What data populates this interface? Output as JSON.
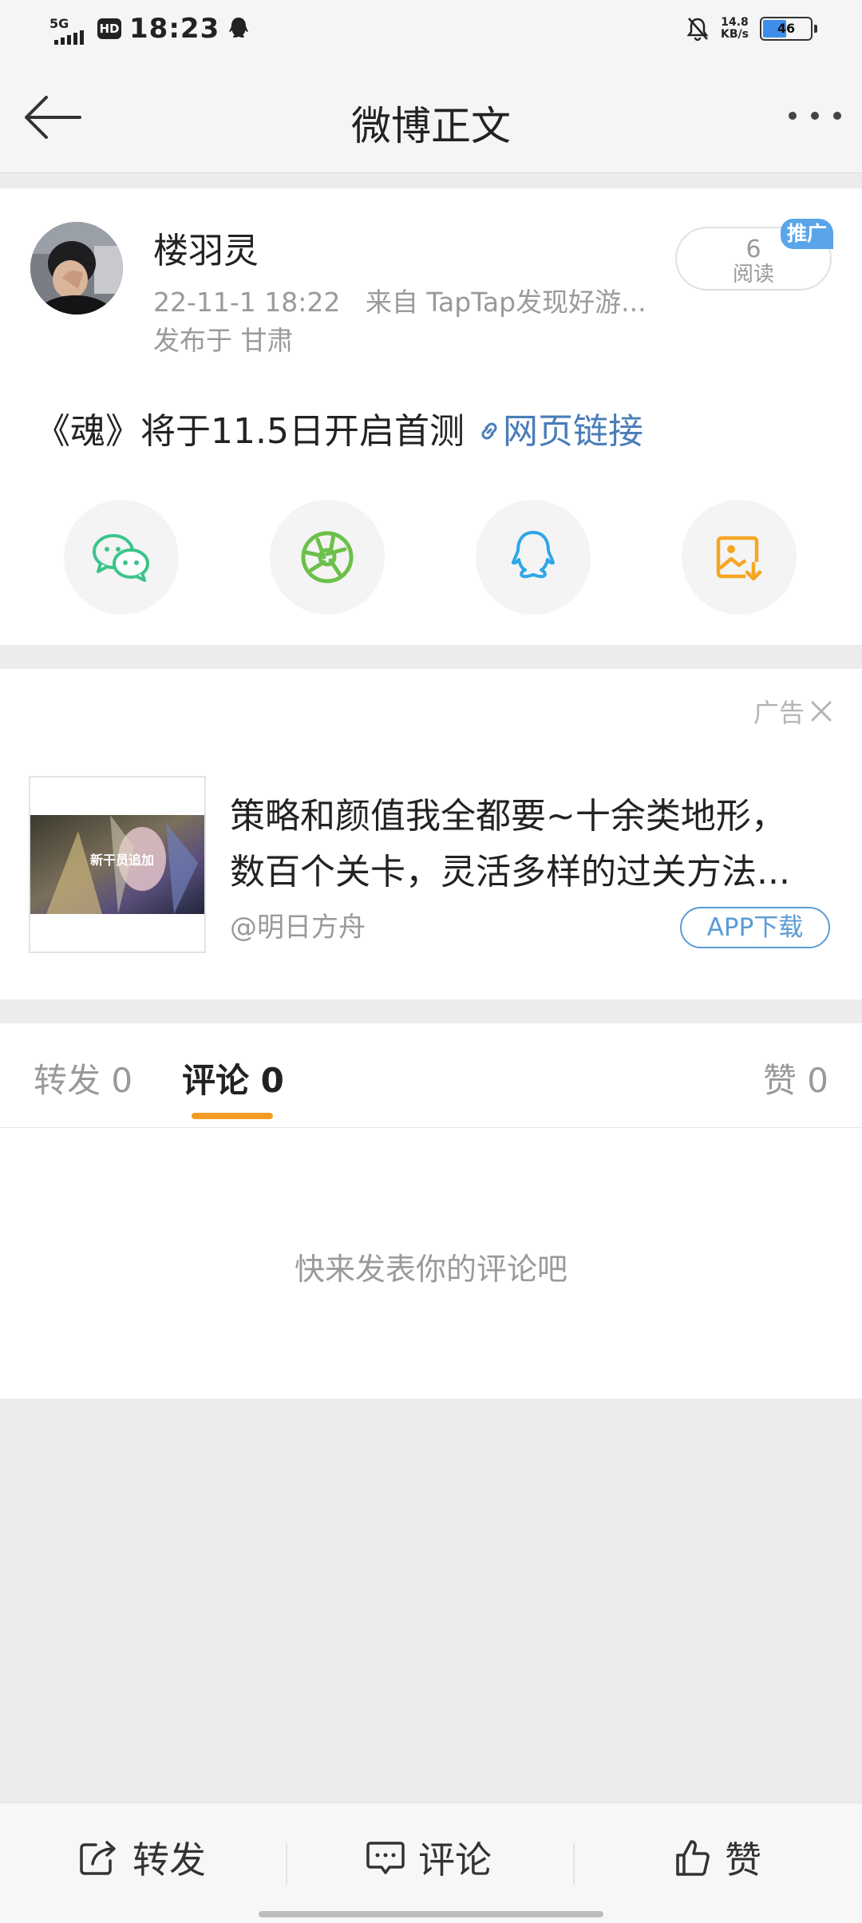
{
  "status_bar": {
    "network": "5G",
    "hd": "HD",
    "time": "18:23",
    "speed_value": "14.8",
    "speed_unit": "KB/s",
    "battery": "46",
    "battery_level": 0.46
  },
  "nav": {
    "title": "微博正文"
  },
  "post": {
    "author": "楼羽灵",
    "date": "22-11-1 18:22",
    "source": "来自 TapTap发现好游...",
    "location": "发布于 甘肃",
    "reads_count": "6",
    "reads_label": "阅读",
    "promo_tag": "推广",
    "text": "《魂》将于11.5日开启首测",
    "link_text": "网页链接",
    "share_icons": [
      "wechat-icon",
      "moments-icon",
      "qq-icon",
      "save-image-icon"
    ]
  },
  "ad": {
    "label": "广告",
    "title": "策略和颜值我全都要~十余类地形，\n数百个关卡，灵活多样的过关方法...",
    "source": "@明日方舟",
    "button": "APP下载",
    "thumb_text": "新干员追加"
  },
  "tabs": {
    "repost": "转发 0",
    "comment": "评论 0",
    "like": "赞 0",
    "active": "comment"
  },
  "comments": {
    "empty_text": "快来发表你的评论吧"
  },
  "bottom_bar": {
    "repost": "转发",
    "comment": "评论",
    "like": "赞"
  },
  "colors": {
    "accent_orange": "#f19c22",
    "link_blue": "#4a7db8",
    "wechat_green": "#3cc48a",
    "moments_green": "#6cc04a",
    "qq_blue": "#2fa6e6",
    "save_orange": "#f5a623"
  }
}
